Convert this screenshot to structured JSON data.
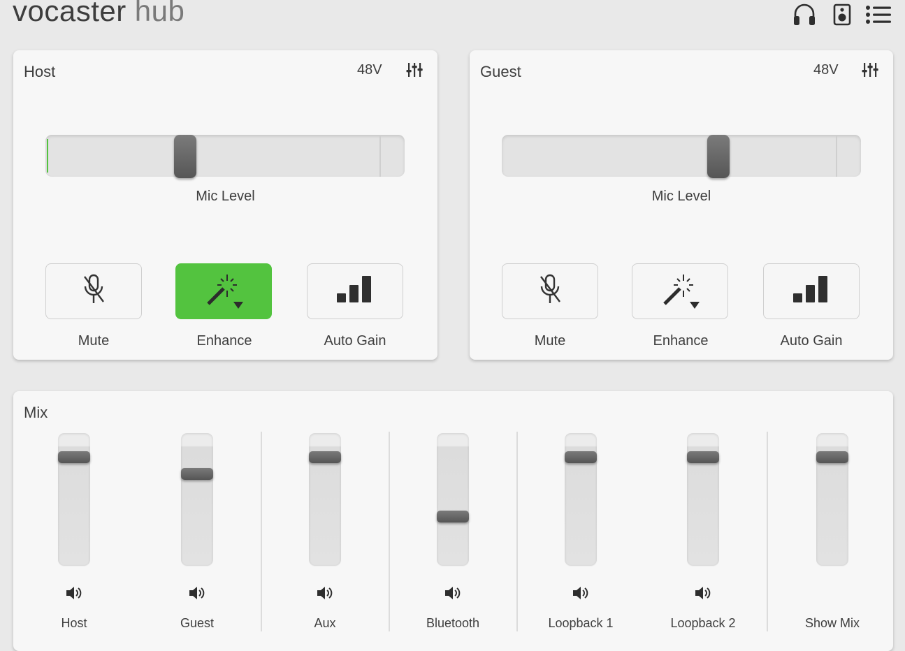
{
  "app": {
    "logo_main": "vocaster",
    "logo_sub": "hub"
  },
  "topbar": {
    "icons": [
      "headphones-icon",
      "speaker-icon",
      "menu-icon"
    ]
  },
  "host": {
    "title": "Host",
    "phantom_label": "48V",
    "mic_level_label": "Mic Level",
    "mic_level": 0.42,
    "buttons": {
      "mute": "Mute",
      "enhance": "Enhance",
      "auto_gain": "Auto Gain"
    },
    "enhance_active": true
  },
  "guest": {
    "title": "Guest",
    "phantom_label": "48V",
    "mic_level_label": "Mic Level",
    "mic_level": 0.6,
    "buttons": {
      "mute": "Mute",
      "enhance": "Enhance",
      "auto_gain": "Auto Gain"
    },
    "enhance_active": false
  },
  "mix": {
    "title": "Mix",
    "channels": [
      {
        "label": "Host",
        "level": 0.85
      },
      {
        "label": "Guest",
        "level": 0.71
      },
      {
        "label": "Aux",
        "level": 0.85
      },
      {
        "label": "Bluetooth",
        "level": 0.36
      },
      {
        "label": "Loopback 1",
        "level": 0.85
      },
      {
        "label": "Loopback 2",
        "level": 0.85
      },
      {
        "label": "Show Mix",
        "level": 0.85
      }
    ]
  },
  "colors": {
    "accent_green": "#53c33f",
    "background": "#e9e9e9",
    "panel": "#f7f7f7"
  }
}
